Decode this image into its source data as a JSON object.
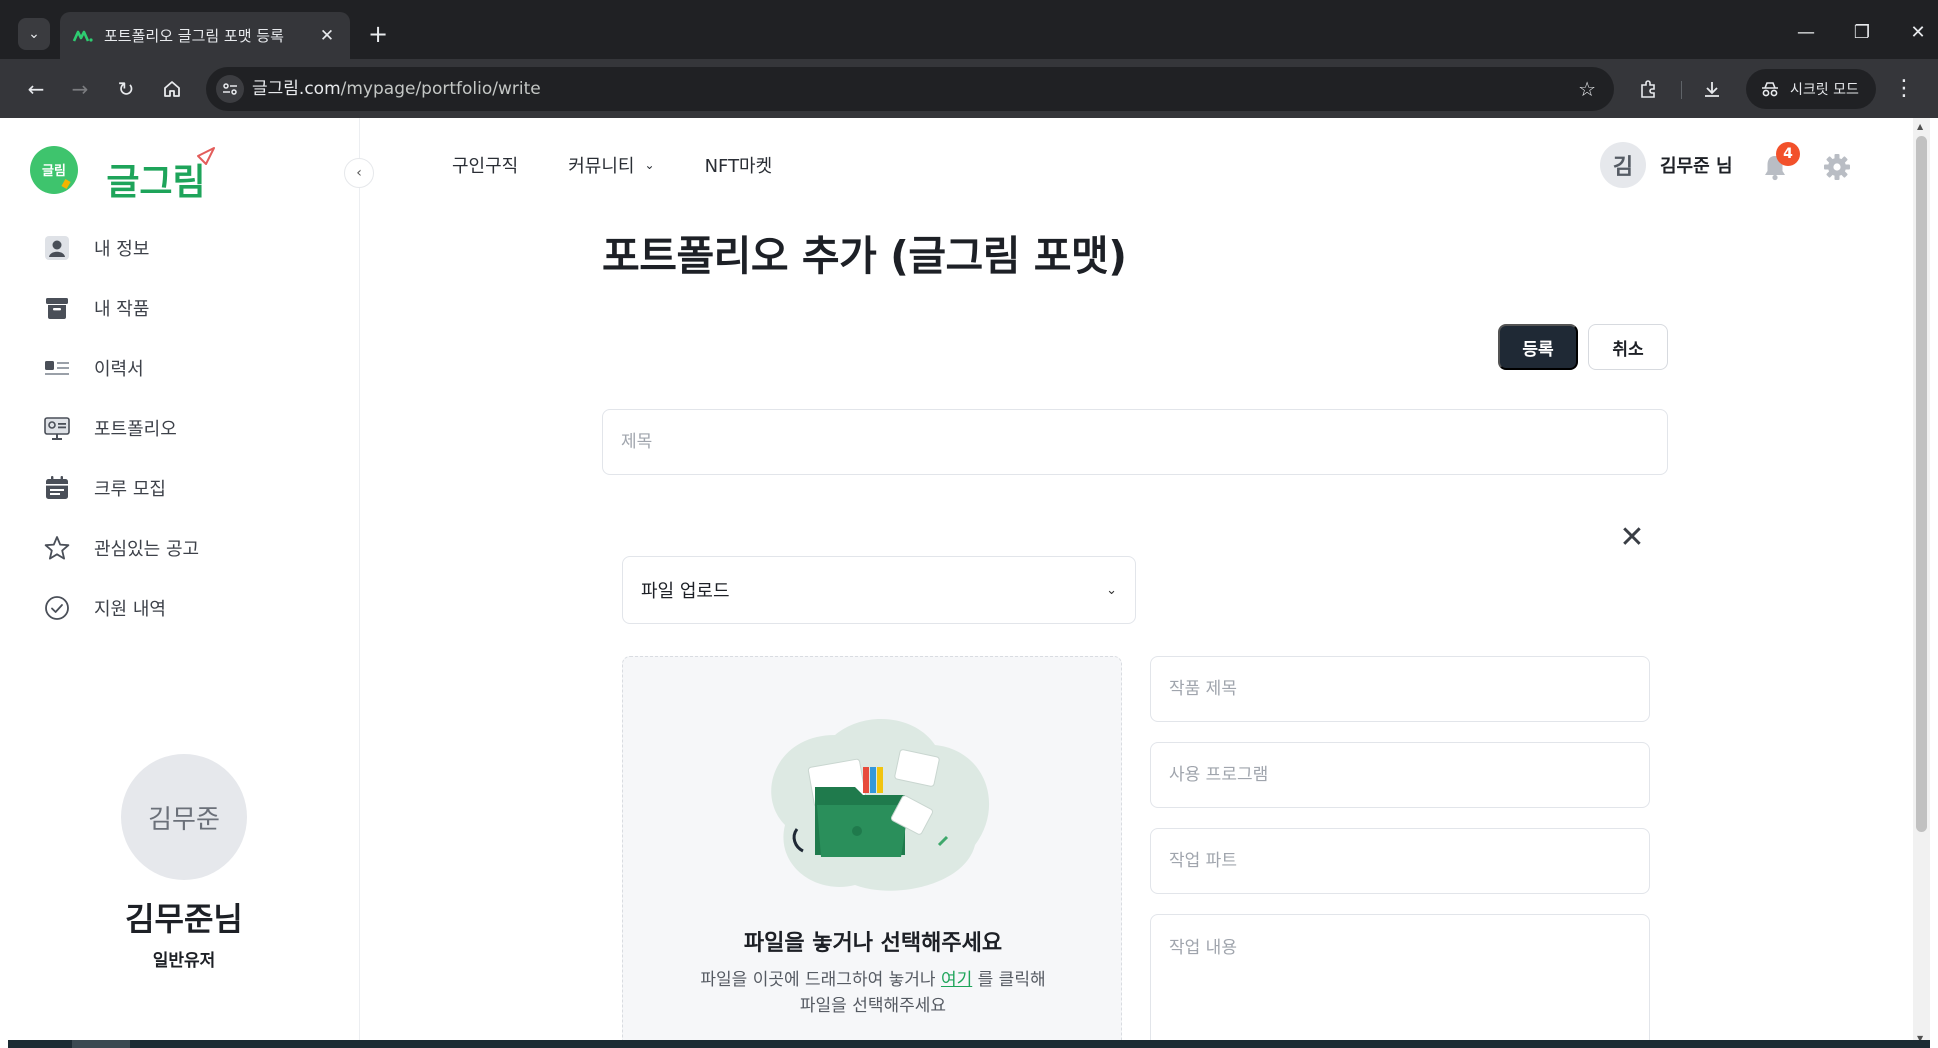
{
  "browser": {
    "tab_title": "포트폴리오 글그림 포맷 등록",
    "url_host": "글그림.com",
    "url_path": "/mypage/portfolio/write",
    "incognito_label": "시크릿 모드"
  },
  "header": {
    "nav": [
      {
        "label": "구인구직"
      },
      {
        "label": "커뮤니티"
      },
      {
        "label": "NFT마켓"
      }
    ],
    "user_initial": "김",
    "user_name": "김무준 님",
    "notification_count": "4"
  },
  "sidebar": {
    "logo_badge": "글림",
    "logo_text": "글그림",
    "items": [
      {
        "label": "내 정보",
        "icon": "user-icon"
      },
      {
        "label": "내 작품",
        "icon": "archive-icon"
      },
      {
        "label": "이력서",
        "icon": "resume-icon"
      },
      {
        "label": "포트폴리오",
        "icon": "portfolio-icon"
      },
      {
        "label": "크루 모집",
        "icon": "calendar-icon"
      },
      {
        "label": "관심있는 공고",
        "icon": "star-icon"
      },
      {
        "label": "지원 내역",
        "icon": "check-circle-icon"
      }
    ],
    "profile": {
      "avatar_text": "김무준",
      "name": "김무준님",
      "role": "일반유저"
    }
  },
  "main": {
    "title": "포트폴리오 추가 (글그림 포맷)",
    "register_label": "등록",
    "cancel_label": "취소",
    "title_placeholder": "제목",
    "upload_select": "파일 업로드",
    "dropzone": {
      "title": "파일을 놓거나 선택해주세요",
      "desc_before": "파일을 이곳에 드래그하여 놓거나",
      "link": "여기",
      "desc_after": "를 클릭해",
      "desc_line2": "파일을 선택해주세요"
    },
    "fields": {
      "work_title": "작품 제목",
      "program": "사용 프로그램",
      "part": "작업 파트",
      "content": "작업 내용"
    }
  },
  "colors": {
    "brand_green": "#1ea45a",
    "primary_button": "#1f2935",
    "badge": "#f2512b"
  }
}
